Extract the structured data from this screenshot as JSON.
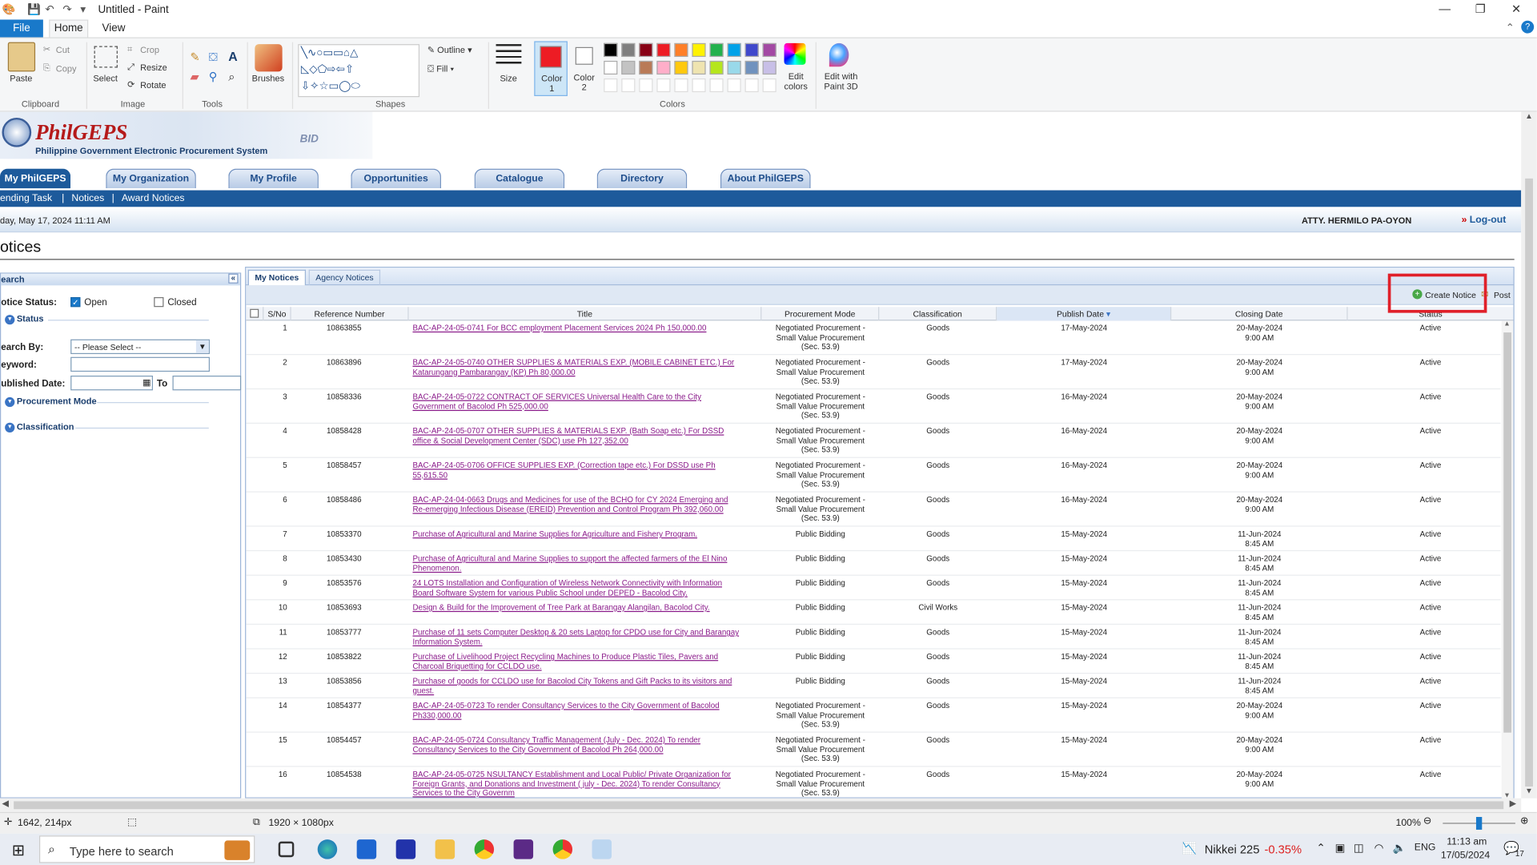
{
  "window": {
    "title": "Untitled - Paint"
  },
  "ribbon": {
    "tabs": [
      "File",
      "Home",
      "View"
    ],
    "clipboard": {
      "paste": "Paste",
      "cut": "Cut",
      "copy": "Copy",
      "label": "Clipboard"
    },
    "image": {
      "select": "Select",
      "crop": "Crop",
      "resize": "Resize",
      "rotate": "Rotate",
      "label": "Image"
    },
    "tools": {
      "label": "Tools"
    },
    "brushes": "Brushes",
    "shapes": {
      "outline": "Outline",
      "fill": "Fill",
      "label": "Shapes"
    },
    "size": "Size",
    "color1": "Color 1",
    "color2": "Color 2",
    "edit_colors": "Edit colors",
    "edit_paint3d": "Edit with Paint 3D",
    "colors_label": "Colors",
    "palette_row1": [
      "#000000",
      "#7f7f7f",
      "#880015",
      "#ed1c24",
      "#ff7f27",
      "#fff200",
      "#22b14c",
      "#00a2e8",
      "#3f48cc",
      "#a349a4"
    ],
    "palette_row2": [
      "#ffffff",
      "#c3c3c3",
      "#b97a57",
      "#ffaec9",
      "#ffc90e",
      "#efe4b0",
      "#b5e61d",
      "#99d9ea",
      "#7092be",
      "#c8bfe7"
    ]
  },
  "site": {
    "logo": "PhilGEPS",
    "logo_sub": "Philippine Government Electronic Procurement System",
    "banner_text": "BID",
    "nav": [
      "My PhilGEPS",
      "My Organization",
      "My Profile",
      "Opportunities",
      "Catalogue",
      "Directory",
      "About PhilGEPS"
    ],
    "subnav": [
      "ending Task",
      "|",
      "Notices",
      "|",
      "Award Notices"
    ],
    "date": "day, May 17, 2024 11:11 AM",
    "user": "ATTY. HERMILO PA-OYON",
    "logout": "Log-out",
    "page_title": "otices"
  },
  "search": {
    "header": "earch",
    "notice_status": "otice Status:",
    "open": "Open",
    "closed": "Closed",
    "status": "Status",
    "search_by": "earch By:",
    "search_by_value": "-- Please Select --",
    "keyword": "eyword:",
    "published_date": "ublished Date:",
    "to": "To",
    "procurement_mode": "Procurement Mode",
    "classification": "Classification"
  },
  "main": {
    "tabs": [
      "My Notices",
      "Agency Notices"
    ],
    "create_notice": "Create Notice",
    "post": "Post",
    "columns": [
      "S/No",
      "Reference Number",
      "Title",
      "Procurement Mode",
      "Classification",
      "Publish Date",
      "Closing Date",
      "Status"
    ],
    "rows": [
      {
        "no": "1",
        "ref": "10863855",
        "title": [
          "BAC-AP-24-05-0741  For BCC employment Placement Services 2024  Ph 150,000.00"
        ],
        "mode": [
          "Negotiated Procurement -",
          "Small Value Procurement",
          "(Sec. 53.9)"
        ],
        "cls": "Goods",
        "pub": "17-May-2024",
        "close": [
          "20-May-2024",
          "9:00 AM"
        ],
        "status": "Active"
      },
      {
        "no": "2",
        "ref": "10863896",
        "title": [
          "BAC-AP-24-05-0740 OTHER SUPPLIES & MATERIALS EXP. (MOBILE CABINET ETC.) For",
          "Katarungang Pambarangay (KP)  Ph 80,000.00"
        ],
        "mode": [
          "Negotiated Procurement -",
          "Small Value Procurement",
          "(Sec. 53.9)"
        ],
        "cls": "Goods",
        "pub": "17-May-2024",
        "close": [
          "20-May-2024",
          "9:00 AM"
        ],
        "status": "Active"
      },
      {
        "no": "3",
        "ref": "10858336",
        "title": [
          "BAC-AP-24-05-0722 CONTRACT OF SERVICES Universal Health Care  to the City",
          "Government of Bacolod Ph 525,000.00"
        ],
        "mode": [
          "Negotiated Procurement -",
          "Small Value Procurement",
          "(Sec. 53.9)"
        ],
        "cls": "Goods",
        "pub": "16-May-2024",
        "close": [
          "20-May-2024",
          "9:00 AM"
        ],
        "status": "Active"
      },
      {
        "no": "4",
        "ref": "10858428",
        "title": [
          "BAC-AP-24-05-0707 OTHER SUPPLIES & MATERIALS EXP. (Bath Soap etc.) For DSSD",
          "office & Social Development Center (SDC) use  Ph 127,352.00"
        ],
        "mode": [
          "Negotiated Procurement -",
          "Small Value Procurement",
          "(Sec. 53.9)"
        ],
        "cls": "Goods",
        "pub": "16-May-2024",
        "close": [
          "20-May-2024",
          "9:00 AM"
        ],
        "status": "Active"
      },
      {
        "no": "5",
        "ref": "10858457",
        "title": [
          "BAC-AP-24-05-0706 OFFICE SUPPLIES EXP. (Correction tape etc.) For DSSD use  Ph",
          "55,615.50"
        ],
        "mode": [
          "Negotiated Procurement -",
          "Small Value Procurement",
          "(Sec. 53.9)"
        ],
        "cls": "Goods",
        "pub": "16-May-2024",
        "close": [
          "20-May-2024",
          "9:00 AM"
        ],
        "status": "Active"
      },
      {
        "no": "6",
        "ref": "10858486",
        "title": [
          "BAC-AP-24-04-0663 Drugs and Medicines for use of the BCHO for CY 2024 Emerging and",
          "Re-emerging Infectious Disease (EREID) Prevention and Control Program  Ph 392,060.00"
        ],
        "mode": [
          "Negotiated Procurement -",
          "Small Value Procurement",
          "(Sec. 53.9)"
        ],
        "cls": "Goods",
        "pub": "16-May-2024",
        "close": [
          "20-May-2024",
          "9:00 AM"
        ],
        "status": "Active"
      },
      {
        "no": "7",
        "ref": "10853370",
        "title": [
          "Purchase of Agricultural and Marine Supplies for Agriculture and Fishery Program."
        ],
        "mode": [
          "Public Bidding"
        ],
        "cls": "Goods",
        "pub": "15-May-2024",
        "close": [
          "11-Jun-2024",
          "8:45 AM"
        ],
        "status": "Active"
      },
      {
        "no": "8",
        "ref": "10853430",
        "title": [
          "Purchase of Agricultural and Marine Supplies to support the affected farmers of the El Nino",
          "Phenomenon."
        ],
        "mode": [
          "Public Bidding"
        ],
        "cls": "Goods",
        "pub": "15-May-2024",
        "close": [
          "11-Jun-2024",
          "8:45 AM"
        ],
        "status": "Active"
      },
      {
        "no": "9",
        "ref": "10853576",
        "title": [
          "24 LOTS Installation and Configuration of Wireless Network Connectivity with Information",
          "Board Software System for various Public School under DEPED - Bacolod City."
        ],
        "mode": [
          "Public Bidding"
        ],
        "cls": "Goods",
        "pub": "15-May-2024",
        "close": [
          "11-Jun-2024",
          "8:45 AM"
        ],
        "status": "Active"
      },
      {
        "no": "10",
        "ref": "10853693",
        "title": [
          "Design & Build for the Improvement of Tree Park at Barangay Alangilan, Bacolod City."
        ],
        "mode": [
          "Public Bidding"
        ],
        "cls": "Civil Works",
        "pub": "15-May-2024",
        "close": [
          "11-Jun-2024",
          "8:45 AM"
        ],
        "status": "Active"
      },
      {
        "no": "11",
        "ref": "10853777",
        "title": [
          "Purchase of 11 sets Computer Desktop & 20 sets Laptop for CPDO use for City and Barangay",
          "Information System."
        ],
        "mode": [
          "Public Bidding"
        ],
        "cls": "Goods",
        "pub": "15-May-2024",
        "close": [
          "11-Jun-2024",
          "8:45 AM"
        ],
        "status": "Active"
      },
      {
        "no": "12",
        "ref": "10853822",
        "title": [
          "Purchase of Livelihood Project Recycling Machines to Produce Plastic Tiles, Pavers and",
          "Charcoal Briquetting for CCLDO use."
        ],
        "mode": [
          "Public Bidding"
        ],
        "cls": "Goods",
        "pub": "15-May-2024",
        "close": [
          "11-Jun-2024",
          "8:45 AM"
        ],
        "status": "Active"
      },
      {
        "no": "13",
        "ref": "10853856",
        "title": [
          "Purchase of goods for CCLDO use for Bacolod City Tokens and Gift Packs to its visitors and",
          "guest."
        ],
        "mode": [
          "Public Bidding"
        ],
        "cls": "Goods",
        "pub": "15-May-2024",
        "close": [
          "11-Jun-2024",
          "8:45 AM"
        ],
        "status": "Active"
      },
      {
        "no": "14",
        "ref": "10854377",
        "title": [
          "BAC-AP-24-05-0723 To render Consultancy Services to the City Government of Bacolod",
          "Ph330,000.00"
        ],
        "mode": [
          "Negotiated Procurement -",
          "Small Value Procurement",
          "(Sec. 53.9)"
        ],
        "cls": "Goods",
        "pub": "15-May-2024",
        "close": [
          "20-May-2024",
          "9:00 AM"
        ],
        "status": "Active"
      },
      {
        "no": "15",
        "ref": "10854457",
        "title": [
          "BAC-AP-24-05-0724  Consultancy Traffic Management (July - Dec. 2024) To render",
          "Consultancy Services to the City Government of Bacolod  Ph 264,000.00"
        ],
        "mode": [
          "Negotiated Procurement -",
          "Small Value Procurement",
          "(Sec. 53.9)"
        ],
        "cls": "Goods",
        "pub": "15-May-2024",
        "close": [
          "20-May-2024",
          "9:00 AM"
        ],
        "status": "Active"
      },
      {
        "no": "16",
        "ref": "10854538",
        "title": [
          "BAC-AP-24-05-0725 NSULTANCY Establishment and Local Public/ Private Organization for",
          "Foreign Grants, and Donations and Investment ( july - Dec. 2024) To render Consultancy",
          "Services to the City Governm"
        ],
        "mode": [
          "Negotiated Procurement -",
          "Small Value Procurement",
          "(Sec. 53.9)"
        ],
        "cls": "Goods",
        "pub": "15-May-2024",
        "close": [
          "20-May-2024",
          "9:00 AM"
        ],
        "status": "Active"
      }
    ]
  },
  "statusbar": {
    "cursor": "1642, 214px",
    "canvas_size": "1920 × 1080px",
    "zoom": "100%",
    "zoom_level": 0.5
  },
  "taskbar": {
    "search_placeholder": "Type here to search",
    "stock_name": "Nikkei 225",
    "stock_change": "-0.35%",
    "lang": "ENG",
    "time": "11:13 am",
    "date": "17/05/2024",
    "notif": "17"
  }
}
